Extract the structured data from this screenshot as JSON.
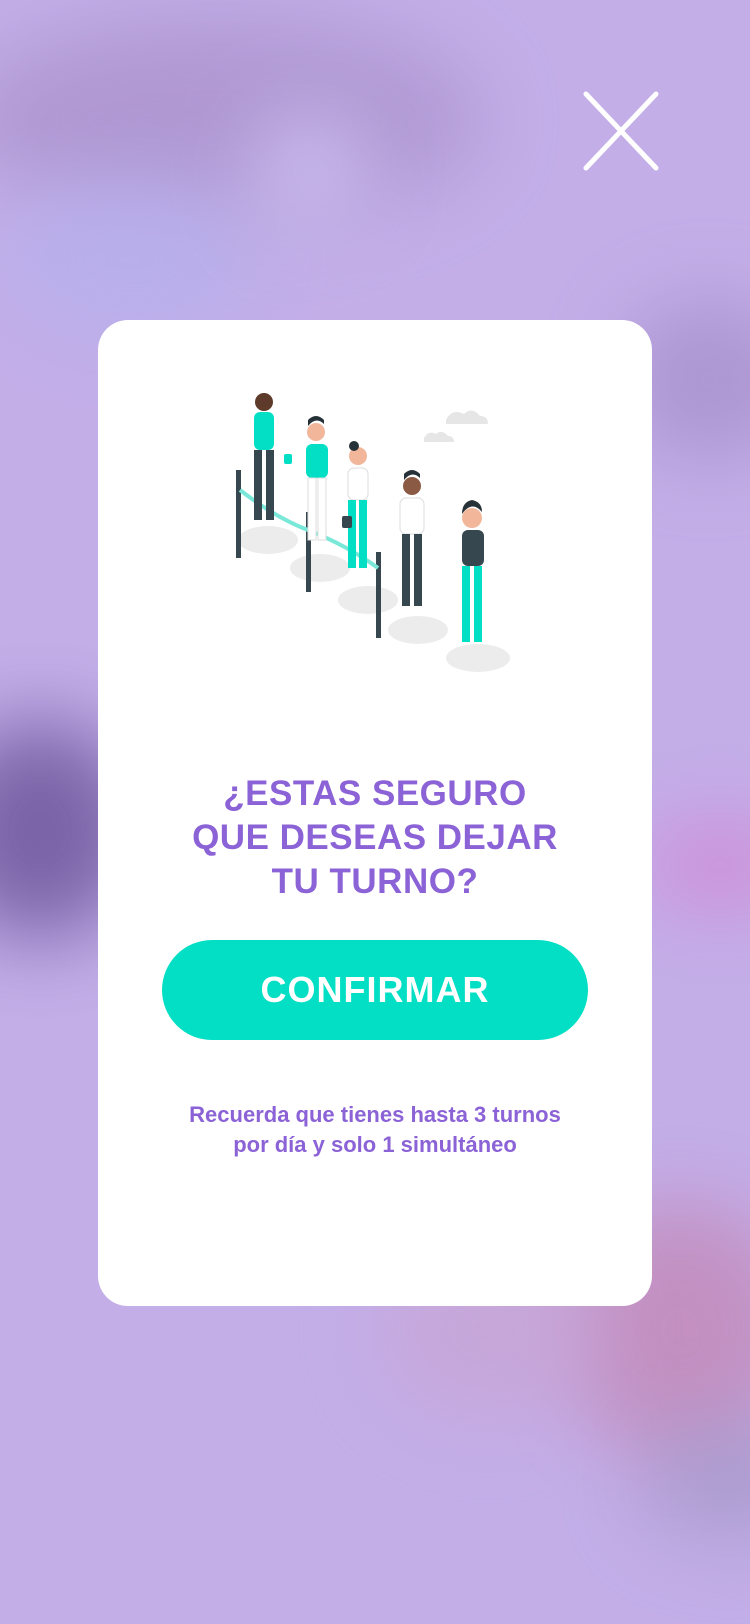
{
  "close": {
    "icon": "close-icon"
  },
  "dialog": {
    "illustration": "people-waiting-in-line-illustration",
    "title_lines": [
      "¿ESTAS SEGURO",
      "QUE DESEAS DEJAR",
      "TU TURNO?"
    ],
    "confirm_label": "CONFIRMAR",
    "note_lines": [
      "Recuerda que tienes hasta 3 turnos",
      "por día y solo 1 simultáneo"
    ]
  },
  "colors": {
    "accent_purple": "#8b63d6",
    "confirm_teal": "#02dfc4",
    "backdrop": "#c3aee8"
  }
}
